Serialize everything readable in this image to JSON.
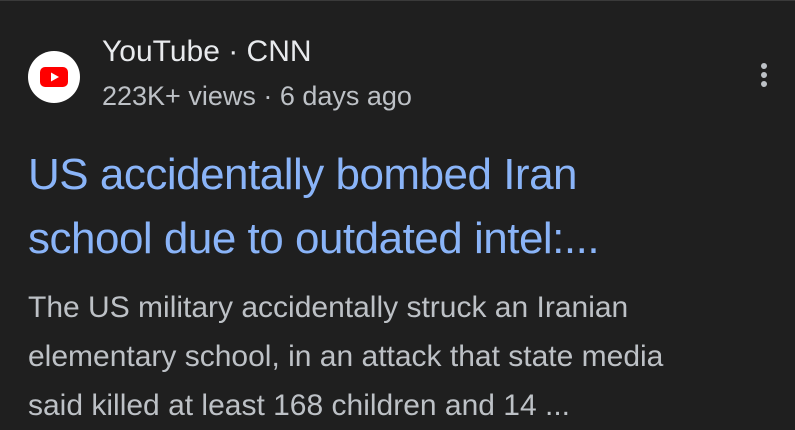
{
  "result": {
    "source": "YouTube · CNN",
    "meta": "223K+ views · 6 days ago",
    "title_line1": "US accidentally bombed Iran",
    "title_line2": "school due to outdated intel:...",
    "snippet_line1": "The US military accidentally struck an Iranian",
    "snippet_line2": "elementary school, in an attack that state media",
    "snippet_line3": "said killed at least 168 children and 14 ...",
    "icons": {
      "favicon": "youtube-logo-icon",
      "menu": "more-vert-icon"
    }
  },
  "colors": {
    "background": "#1f1f1f",
    "title_link": "#8ab4f8",
    "source_text": "#e8eaed",
    "secondary_text": "#bdc1c6",
    "youtube_red": "#ff0000"
  }
}
